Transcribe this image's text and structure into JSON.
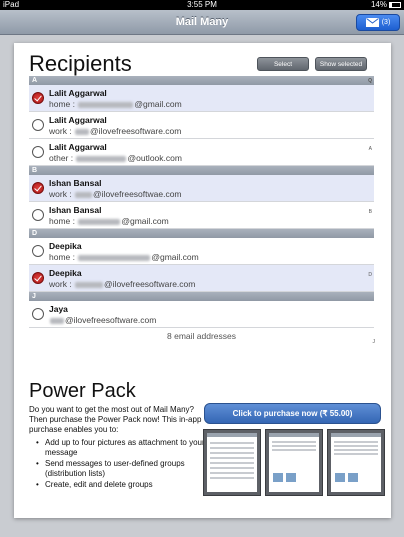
{
  "status_bar": {
    "device": "iPad",
    "time": "3:55 PM",
    "battery": "14%"
  },
  "nav": {
    "title": "Mail Many",
    "compose_count": "(3)"
  },
  "recipients": {
    "heading": "Recipients",
    "select_label": "Select",
    "show_selected_label": "Show selected",
    "sections": [
      {
        "letter": "A",
        "rows": [
          {
            "name": "Lalit Aggarwal",
            "label": "home :",
            "domain": "@gmail.com",
            "selected": true
          },
          {
            "name": "Lalit Aggarwal",
            "label": "work :",
            "domain": "@ilovefreesoftware.com",
            "selected": false
          },
          {
            "name": "Lalit Aggarwal",
            "label": "other :",
            "domain": "@outlook.com",
            "selected": false
          }
        ]
      },
      {
        "letter": "B",
        "rows": [
          {
            "name": "Ishan Bansal",
            "label": "work :",
            "domain": "@ilovefreesoftwae.com",
            "selected": true
          },
          {
            "name": "Ishan Bansal",
            "label": "home :",
            "domain": "@gmail.com",
            "selected": false
          }
        ]
      },
      {
        "letter": "D",
        "rows": [
          {
            "name": "Deepika",
            "label": "home :",
            "domain": "@gmail.com",
            "selected": false
          },
          {
            "name": "Deepika",
            "label": "work :",
            "domain": "@ilovefreesoftware.com",
            "selected": true
          }
        ]
      },
      {
        "letter": "J",
        "rows": [
          {
            "name": "Jaya",
            "label": "",
            "domain": "@ilovefreesoftware.com",
            "selected": false
          }
        ]
      }
    ],
    "index": [
      "Q",
      "A",
      "B",
      "D",
      "J"
    ],
    "count_text": "8 email addresses"
  },
  "power_pack": {
    "heading": "Power Pack",
    "description": "Do you want to get the most out of Mail Many? Then purchase the Power Pack now! This in-app purchase enables you to:",
    "features": [
      "Add up to four pictures as attachment to your message",
      "Send messages to user-defined groups (distribution lists)",
      "Create, edit and delete groups"
    ],
    "purchase_label": "Click to purchase now (₹ 55.00)"
  }
}
